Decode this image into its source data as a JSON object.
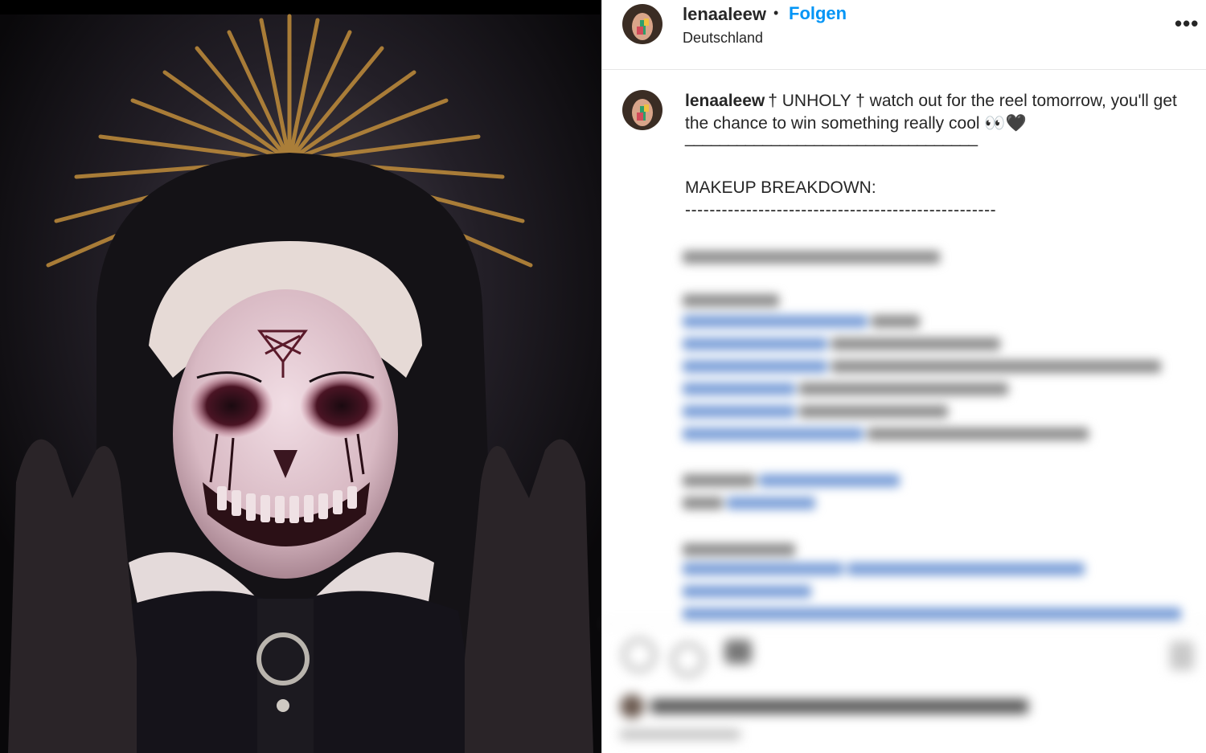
{
  "post": {
    "username": "lenaaleew",
    "separator": "•",
    "follow_label": "Folgen",
    "location": "Deutschland",
    "more_label": "•••"
  },
  "caption": {
    "username": "lenaaleew",
    "text": "† UNHOLY † watch out for the reel tomorrow, you'll get the chance to win something really cool 👀🖤",
    "divider_line": "__________________________________",
    "heading": "MAKEUP BREAKDOWN:",
    "dashes": "---------------------------------------------------"
  },
  "colors": {
    "link_blue": "#0095f6",
    "text": "#262626",
    "border": "#dbdbdb"
  }
}
